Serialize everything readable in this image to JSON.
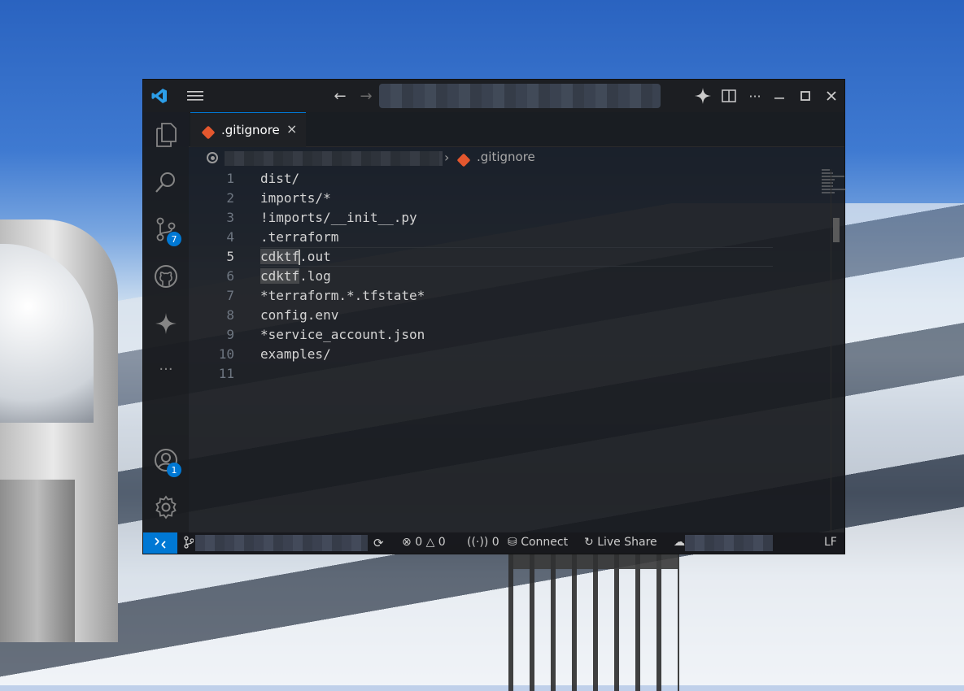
{
  "window": {
    "title_icons": {
      "app": "vscode-logo-icon",
      "menu": "hamburger-menu-icon",
      "back": "arrow-left-icon",
      "forward": "arrow-right-icon",
      "copilot": "copilot-sparkle-icon",
      "layout": "split-layout-icon",
      "more": "ellipsis-icon",
      "minimize": "minimize-icon",
      "maximize": "maximize-icon",
      "close": "close-icon"
    }
  },
  "activity_bar": {
    "source_control_badge": "7",
    "accounts_badge": "1"
  },
  "tab": {
    "label": ".gitignore",
    "close_glyph": "×"
  },
  "breadcrumb": {
    "file": ".gitignore",
    "separator": "›"
  },
  "editor": {
    "lines": [
      {
        "n": "1",
        "text": "dist/"
      },
      {
        "n": "2",
        "text": "imports/*"
      },
      {
        "n": "3",
        "text": "!imports/__init__.py"
      },
      {
        "n": "4",
        "text": ".terraform"
      },
      {
        "n": "5",
        "text": "cdktf.out"
      },
      {
        "n": "6",
        "text": "cdktf.log"
      },
      {
        "n": "7",
        "text": "*terraform.*.tfstate*"
      },
      {
        "n": "8",
        "text": "config.env"
      },
      {
        "n": "9",
        "text": "*service_account.json"
      },
      {
        "n": "10",
        "text": "examples/"
      },
      {
        "n": "11",
        "text": ""
      }
    ],
    "active_line": "5",
    "l5_sel": "cdktf",
    "l5_rest": ".out",
    "l6_sel": "cdktf",
    "l6_rest": ".log"
  },
  "status": {
    "errors": "0",
    "warnings": "0",
    "ports": "0",
    "connect": "Connect",
    "live_share": "Live Share",
    "eol": "LF"
  },
  "colors": {
    "accent": "#0078d4",
    "git_orange": "#e4572e"
  }
}
